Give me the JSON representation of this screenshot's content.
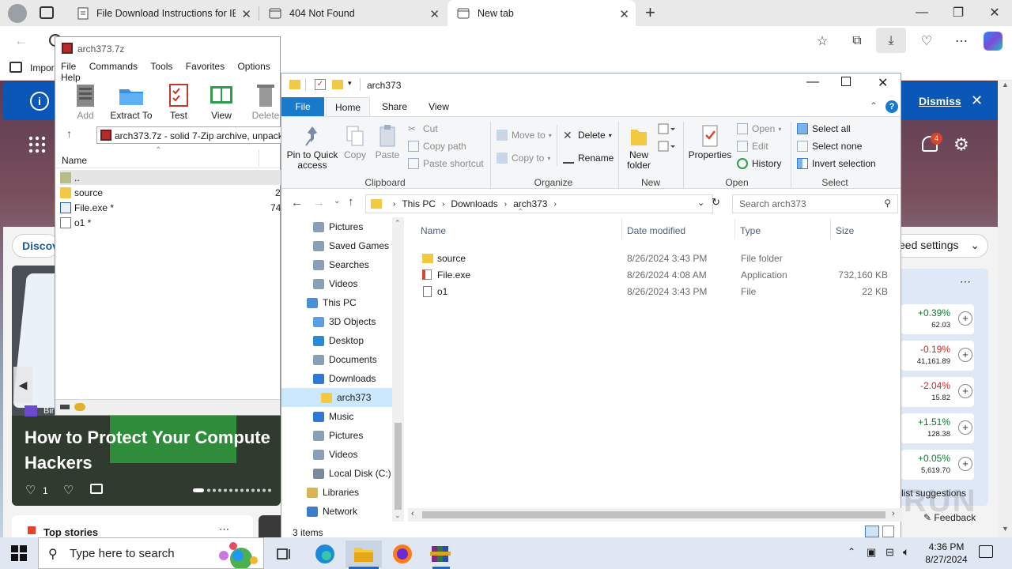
{
  "browser": {
    "tabs": [
      {
        "label": "File Download Instructions for IE",
        "icon": "document-icon"
      },
      {
        "label": "404 Not Found",
        "icon": "page-icon"
      },
      {
        "label": "New tab",
        "icon": "newtab-icon",
        "active": true
      }
    ],
    "favorites_bar_item": "Impor",
    "info_bar": {
      "dismiss_label": "Dismiss"
    },
    "notification_count": "4",
    "feed": {
      "discover_label": "Discov",
      "source": "Bing",
      "headline": "How to Protect Your Compute Hackers",
      "likes": "1",
      "settings_label": "eed settings"
    },
    "stocks": [
      {
        "pct": "+0.39%",
        "val": "62.03",
        "dir": "up"
      },
      {
        "pct": "-0.19%",
        "val": "41,161.89",
        "dir": "down"
      },
      {
        "pct": "-2.04%",
        "val": "15.82",
        "dir": "down"
      },
      {
        "pct": "+1.51%",
        "val": "128.38",
        "dir": "up"
      },
      {
        "pct": "+0.05%",
        "val": "5,619.70",
        "dir": "up"
      }
    ],
    "suggestions_label": "list suggestions",
    "feedback_label": "Feedback",
    "top_stories_label": "Top stories"
  },
  "sevenzip": {
    "title": "arch373.7z",
    "menu": [
      "File",
      "Commands",
      "Tools",
      "Favorites",
      "Options",
      "Help"
    ],
    "toolbar": [
      "Add",
      "Extract To",
      "Test",
      "View",
      "Delete"
    ],
    "address": "arch373.7z - solid 7-Zip archive, unpack",
    "column_name": "Name",
    "rows": [
      {
        "name": "..",
        "size": "",
        "icon": "folder-icon"
      },
      {
        "name": "source",
        "size": "2",
        "icon": "folder-icon"
      },
      {
        "name": "File.exe *",
        "size": "74",
        "icon": "exe-icon"
      },
      {
        "name": "o1 *",
        "size": "",
        "icon": "file-icon"
      }
    ]
  },
  "explorer": {
    "title": "arch373",
    "ribbon_tabs": [
      "File",
      "Home",
      "Share",
      "View"
    ],
    "clipboard": {
      "pin": "Pin to Quick access",
      "copy": "Copy",
      "paste": "Paste",
      "cut": "Cut",
      "copy_path": "Copy path",
      "paste_shortcut": "Paste shortcut",
      "label": "Clipboard"
    },
    "organize": {
      "move_to": "Move to",
      "copy_to": "Copy to",
      "delete": "Delete",
      "rename": "Rename",
      "label": "Organize"
    },
    "new": {
      "new_folder": "New folder",
      "label": "New"
    },
    "open": {
      "properties": "Properties",
      "open": "Open",
      "edit": "Edit",
      "history": "History",
      "label": "Open"
    },
    "select": {
      "select_all": "Select all",
      "select_none": "Select none",
      "invert": "Invert selection",
      "label": "Select"
    },
    "breadcrumb": [
      "This PC",
      "Downloads",
      "arch373"
    ],
    "search_placeholder": "Search arch373",
    "nav": [
      {
        "label": "Pictures",
        "indent": 1
      },
      {
        "label": "Saved Games",
        "indent": 1
      },
      {
        "label": "Searches",
        "indent": 1
      },
      {
        "label": "Videos",
        "indent": 1
      },
      {
        "label": "This PC",
        "indent": 0
      },
      {
        "label": "3D Objects",
        "indent": 1
      },
      {
        "label": "Desktop",
        "indent": 1
      },
      {
        "label": "Documents",
        "indent": 1
      },
      {
        "label": "Downloads",
        "indent": 1
      },
      {
        "label": "arch373",
        "indent": 2,
        "selected": true
      },
      {
        "label": "Music",
        "indent": 1
      },
      {
        "label": "Pictures",
        "indent": 1
      },
      {
        "label": "Videos",
        "indent": 1
      },
      {
        "label": "Local Disk (C:)",
        "indent": 1
      },
      {
        "label": "Libraries",
        "indent": 0
      },
      {
        "label": "Network",
        "indent": 0
      }
    ],
    "columns": [
      "Name",
      "Date modified",
      "Type",
      "Size"
    ],
    "files": [
      {
        "name": "source",
        "date": "8/26/2024 3:43 PM",
        "type": "File folder",
        "size": "",
        "icon": "folder-icon"
      },
      {
        "name": "File.exe",
        "date": "8/26/2024 4:08 AM",
        "type": "Application",
        "size": "732,160 KB",
        "icon": "exe-icon"
      },
      {
        "name": "o1",
        "date": "8/26/2024 3:43 PM",
        "type": "File",
        "size": "22 KB",
        "icon": "file-icon"
      }
    ],
    "status": "3 items"
  },
  "taskbar": {
    "search_placeholder": "Type here to search",
    "time": "4:36 PM",
    "date": "8/27/2024"
  },
  "watermark": "ANY RUN"
}
